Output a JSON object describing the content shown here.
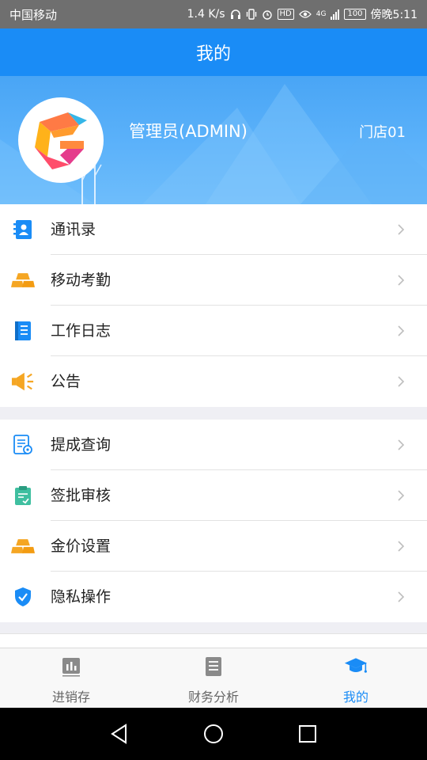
{
  "status_bar": {
    "carrier": "中国移动",
    "speed": "1.4 K/s",
    "hd": "HD",
    "network": "4G",
    "battery": "100",
    "time": "傍晚5:11"
  },
  "header": {
    "title": "我的"
  },
  "profile": {
    "username": "管理员(ADMIN)",
    "store": "门店01"
  },
  "menu_groups": [
    {
      "items": [
        {
          "label": "通讯录",
          "icon": "contacts-icon"
        },
        {
          "label": "移动考勤",
          "icon": "gold-bars-icon"
        },
        {
          "label": "工作日志",
          "icon": "notebook-icon"
        },
        {
          "label": "公告",
          "icon": "megaphone-icon"
        }
      ]
    },
    {
      "items": [
        {
          "label": "提成查询",
          "icon": "document-search-icon"
        },
        {
          "label": "签批审核",
          "icon": "clipboard-check-icon"
        },
        {
          "label": "金价设置",
          "icon": "gold-bars-icon"
        },
        {
          "label": "隐私操作",
          "icon": "shield-check-icon"
        }
      ]
    }
  ],
  "bottom_nav": [
    {
      "label": "进销存",
      "icon": "bar-chart-icon",
      "active": false
    },
    {
      "label": "财务分析",
      "icon": "report-icon",
      "active": false
    },
    {
      "label": "我的",
      "icon": "graduation-cap-icon",
      "active": true
    }
  ],
  "colors": {
    "primary": "#1a8cf6",
    "gold": "#f5a623",
    "megaphone": "#f5a623",
    "teal": "#3fbfa0"
  }
}
